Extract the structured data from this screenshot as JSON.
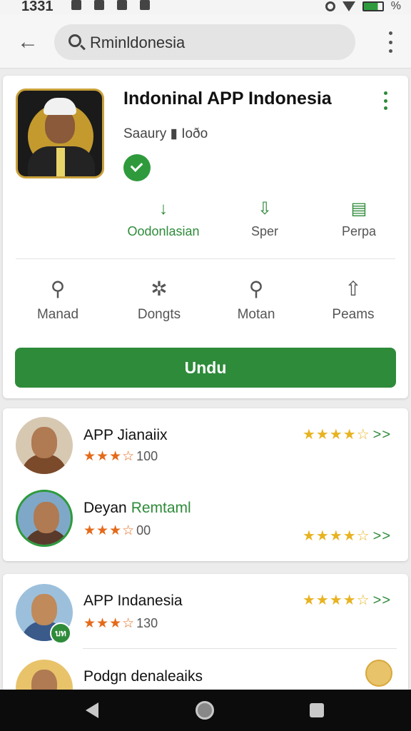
{
  "status_bar": {
    "time": "1331",
    "battery_label": "%"
  },
  "app_bar": {
    "search_text": "Rminldonesia"
  },
  "app": {
    "title": "Indoninal APP Indonesia",
    "developer": "Saaury ▮ Ioðo",
    "actions": [
      {
        "label": "Oodonlasian",
        "icon": "download-icon"
      },
      {
        "label": "Sper",
        "icon": "save-icon"
      },
      {
        "label": "Perpa",
        "icon": "document-icon"
      }
    ],
    "tools": [
      {
        "label": "Manad",
        "icon": "chat-icon"
      },
      {
        "label": "Dongts",
        "icon": "tools-icon"
      },
      {
        "label": "Motan",
        "icon": "search-icon"
      },
      {
        "label": "Peams",
        "icon": "share-icon"
      }
    ],
    "install_label": "Undu"
  },
  "reviews": [
    {
      "name": "APP Jianaiix",
      "tag": "",
      "stars": "★★★☆",
      "count": "100",
      "right_stars": "★★★★☆",
      "arrow": ">>"
    },
    {
      "name": "Deyan",
      "tag": "Remtaml",
      "stars": "★★★☆",
      "count": "00",
      "right_stars": "★★★★☆",
      "arrow": ">>"
    }
  ],
  "more": [
    {
      "name": "APP Indanesia",
      "stars": "★★★☆",
      "count": "130",
      "right_stars": "★★★★☆",
      "arrow": ">>",
      "badge": "บท"
    },
    {
      "name": "Podgn denaleaiks"
    }
  ],
  "colors": {
    "accent": "#2e8b3a",
    "star_orange": "#e46a1a",
    "star_gold": "#e8b322"
  }
}
